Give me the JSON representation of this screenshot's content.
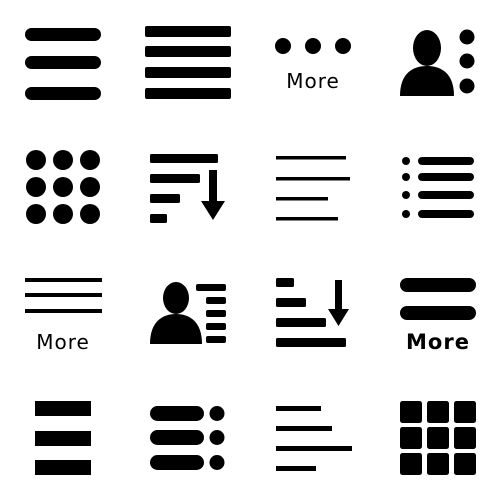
{
  "colors": {
    "icon": "#000000",
    "background": "#ffffff"
  },
  "icons": [
    {
      "name": "hamburger-menu-rounded-icon"
    },
    {
      "name": "menu-four-bars-icon"
    },
    {
      "name": "more-dots-icon",
      "label": "More"
    },
    {
      "name": "user-options-icon"
    },
    {
      "name": "dots-grid-icon"
    },
    {
      "name": "sort-descending-icon"
    },
    {
      "name": "align-left-lines-icon"
    },
    {
      "name": "bulleted-list-icon"
    },
    {
      "name": "menu-lines-more-icon",
      "label": "More"
    },
    {
      "name": "user-list-icon"
    },
    {
      "name": "sort-bars-arrow-icon"
    },
    {
      "name": "menu-bold-more-icon",
      "label": "More"
    },
    {
      "name": "menu-square-bars-icon"
    },
    {
      "name": "bars-with-dots-icon"
    },
    {
      "name": "align-left-text-icon"
    },
    {
      "name": "square-grid-icon"
    }
  ]
}
